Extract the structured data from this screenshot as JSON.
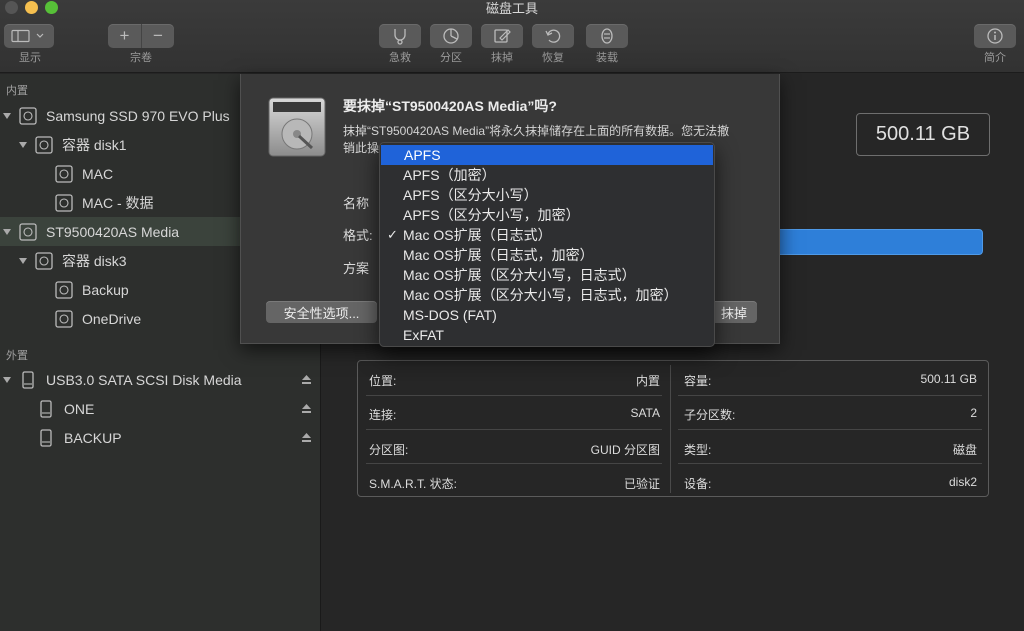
{
  "window": {
    "title": "磁盘工具"
  },
  "toolbar": {
    "view_label": "显示",
    "volume_label": "宗卷",
    "add_symbol": "+",
    "remove_symbol": "−",
    "buttons": [
      {
        "label": "急救",
        "icon": "stethoscope-icon"
      },
      {
        "label": "分区",
        "icon": "partition-icon"
      },
      {
        "label": "抹掉",
        "icon": "erase-icon"
      },
      {
        "label": "恢复",
        "icon": "restore-icon"
      },
      {
        "label": "装载",
        "icon": "mount-icon"
      }
    ],
    "info_label": "简介"
  },
  "sidebar": {
    "internal_header": "内置",
    "external_header": "外置",
    "items": [
      {
        "label": "Samsung SSD 970 EVO Plus"
      },
      {
        "label": "容器 disk1"
      },
      {
        "label": "MAC"
      },
      {
        "label": "MAC - 数据"
      },
      {
        "label": "ST9500420AS Media"
      },
      {
        "label": "容器 disk3"
      },
      {
        "label": "Backup"
      },
      {
        "label": "OneDrive"
      },
      {
        "label": "USB3.0 SATA SCSI Disk Media"
      },
      {
        "label": "ONE"
      },
      {
        "label": "BACKUP"
      }
    ]
  },
  "main": {
    "capacity": "500.11 GB",
    "info": {
      "location_label": "位置:",
      "location_value": "内置",
      "capacity_label": "容量:",
      "capacity_value": "500.11 GB",
      "connection_label": "连接:",
      "connection_value": "SATA",
      "children_label": "子分区数:",
      "children_value": "2",
      "partition_map_label": "分区图:",
      "partition_map_value": "GUID 分区图",
      "type_label": "类型:",
      "type_value": "磁盘",
      "smart_label": "S.M.A.R.T. 状态:",
      "smart_value": "已验证",
      "device_label": "设备:",
      "device_value": "disk2"
    }
  },
  "dialog": {
    "title": "要抹掉“ST9500420AS Media”吗?",
    "message_line1": "抹掉“ST9500420AS Media”将永久抹掉储存在上面的所有数据。您无法撤",
    "message_line2": "销此操",
    "name_label": "名称",
    "format_label": "格式:",
    "scheme_label": "方案",
    "security_button": "安全性选项...",
    "erase_button": "抹掉"
  },
  "format_menu": {
    "items": [
      "APFS",
      "APFS（加密）",
      "APFS（区分大小写）",
      "APFS（区分大小写，加密）",
      "Mac OS扩展（日志式）",
      "Mac OS扩展（日志式，加密）",
      "Mac OS扩展（区分大小写，日志式）",
      "Mac OS扩展（区分大小写，日志式，加密）",
      "MS-DOS (FAT)",
      "ExFAT"
    ],
    "highlighted": "APFS",
    "checked": "Mac OS扩展（日志式）",
    "check_mark": "✓"
  },
  "colors": {
    "accent": "#1f63d9",
    "usage_bar": "#2e7fd9",
    "selected_row": "#3b433c"
  }
}
